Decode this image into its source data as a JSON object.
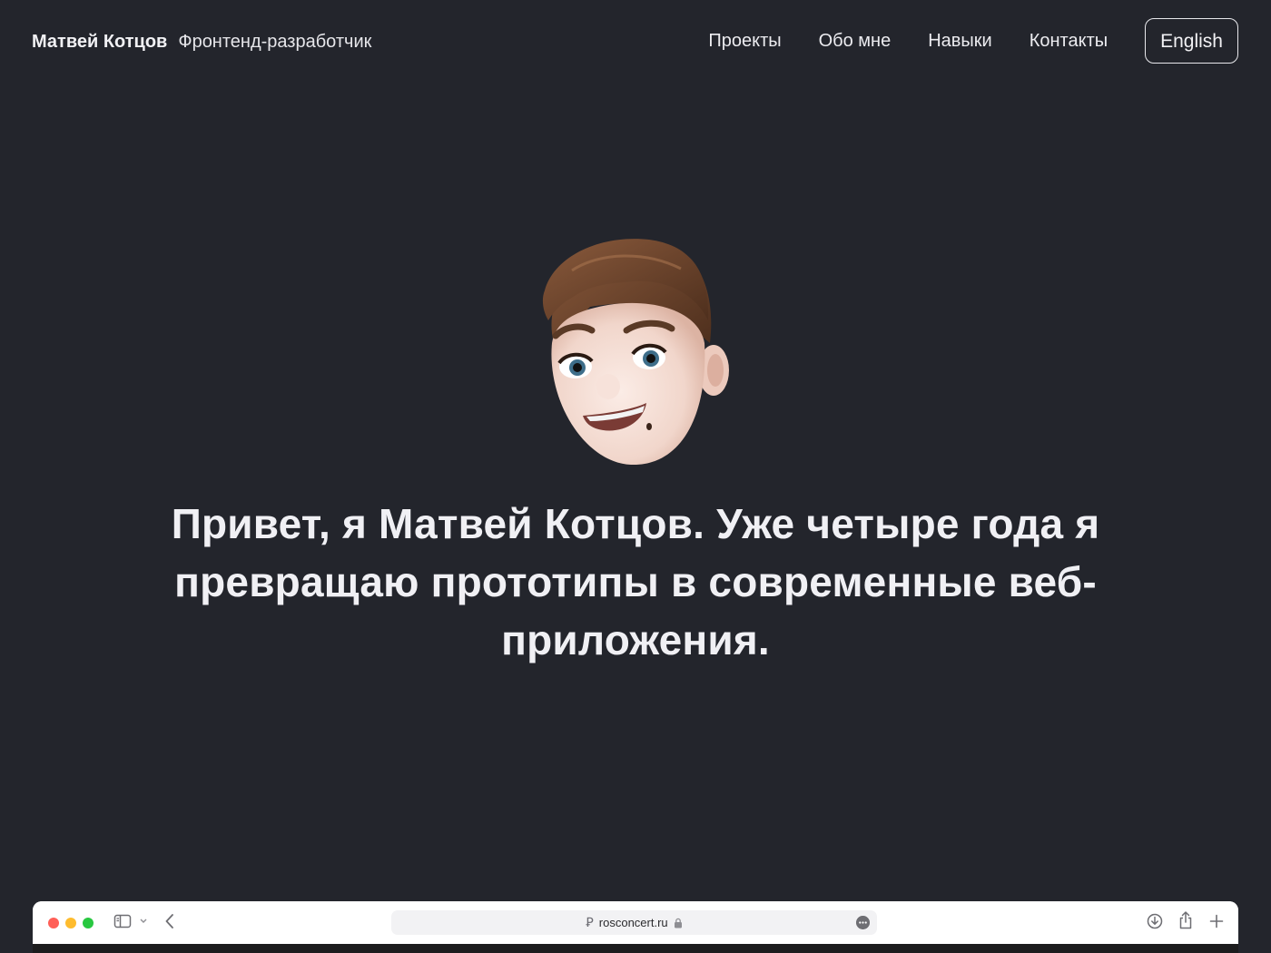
{
  "header": {
    "name": "Матвей Котцов",
    "role": "Фронтенд-разработчик",
    "nav": [
      {
        "label": "Проекты"
      },
      {
        "label": "Обо мне"
      },
      {
        "label": "Навыки"
      },
      {
        "label": "Контакты"
      }
    ],
    "language_button": "English"
  },
  "hero": {
    "avatar_icon": "memoji-avatar-icon",
    "heading": "Привет, я Матвей Котцов. Уже четыре года я превращаю прототипы в современные веб-приложения."
  },
  "browser_preview": {
    "url": "rosconcert.ru",
    "favicon_glyph": "Ꝑ",
    "icons": [
      "sidebar-icon",
      "chevron-down-icon",
      "back-icon",
      "lock-icon",
      "more-icon",
      "download-icon",
      "share-icon",
      "plus-icon"
    ],
    "colors": {
      "close": "#ff5f57",
      "minimize": "#febc2e",
      "zoom": "#28c840"
    }
  },
  "colors": {
    "background": "#23252c",
    "text": "#ececf0"
  }
}
